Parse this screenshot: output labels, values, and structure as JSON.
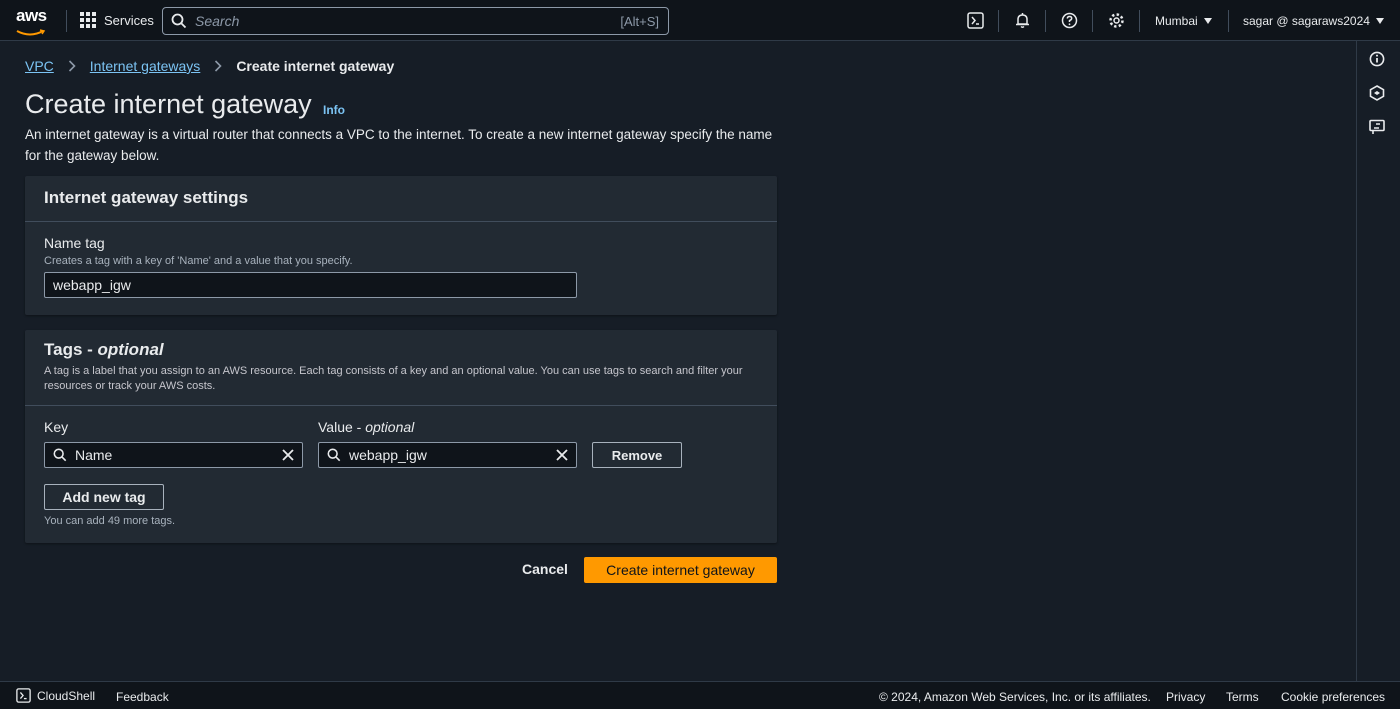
{
  "nav": {
    "logo_text": "aws",
    "services_label": "Services",
    "search_placeholder": "Search",
    "search_shortcut": "[Alt+S]",
    "region": "Mumbai",
    "user": "sagar @ sagaraws2024",
    "icons": [
      "cloudshell-icon",
      "bell-icon",
      "help-icon",
      "settings-icon"
    ]
  },
  "breadcrumb": {
    "items": [
      "VPC",
      "Internet gateways"
    ],
    "current": "Create internet gateway"
  },
  "page": {
    "title": "Create internet gateway",
    "info_label": "Info",
    "description": "An internet gateway is a virtual router that connects a VPC to the internet. To create a new internet gateway specify the name for the gateway below."
  },
  "settings": {
    "title": "Internet gateway settings",
    "name_label": "Name tag",
    "name_desc": "Creates a tag with a key of 'Name' and a value that you specify.",
    "name_value": "webapp_igw"
  },
  "tags": {
    "title_main": "Tags - ",
    "title_optional": "optional",
    "description": "A tag is a label that you assign to an AWS resource. Each tag consists of a key and an optional value. You can use tags to search and filter your resources or track your AWS costs.",
    "key_label": "Key",
    "value_label_main": "Value - ",
    "value_label_optional": "optional",
    "key_value": "Name",
    "value_value": "webapp_igw",
    "remove_label": "Remove",
    "add_label": "Add new tag",
    "hint": "You can add 49 more tags."
  },
  "actions": {
    "cancel": "Cancel",
    "create": "Create internet gateway"
  },
  "footer": {
    "cloudshell": "CloudShell",
    "feedback": "Feedback",
    "copyright": "© 2024, Amazon Web Services, Inc. or its affiliates.",
    "privacy": "Privacy",
    "terms": "Terms",
    "cookies": "Cookie preferences"
  },
  "colors": {
    "accent": "#ff9900",
    "link": "#7cc4f4",
    "panel": "#222a33",
    "background": "#161d26"
  }
}
